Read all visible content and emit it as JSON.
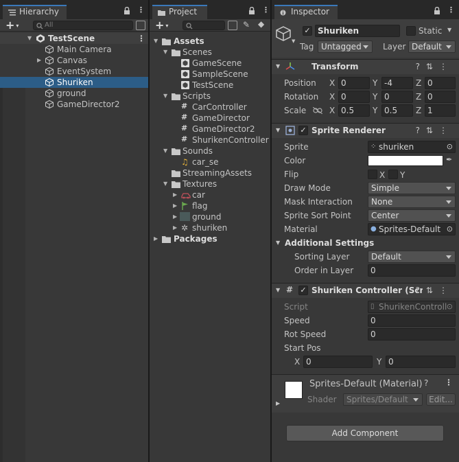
{
  "hierarchy": {
    "tab_label": "Hierarchy",
    "search_placeholder": "All",
    "scene": "TestScene",
    "items": [
      "Main Camera",
      "Canvas",
      "EventSystem",
      "Shuriken",
      "ground",
      "GameDirector2"
    ]
  },
  "project": {
    "tab_label": "Project",
    "assets": "Assets",
    "scenes_folder": "Scenes",
    "scenes": [
      "GameScene",
      "SampleScene",
      "TestScene"
    ],
    "scripts_folder": "Scripts",
    "scripts": [
      "CarController",
      "GameDirector",
      "GameDirector2",
      "ShurikenController"
    ],
    "sounds_folder": "Sounds",
    "sounds": [
      "car_se"
    ],
    "streaming": "StreamingAssets",
    "textures_folder": "Textures",
    "textures": [
      "car",
      "flag",
      "ground",
      "shuriken"
    ],
    "packages": "Packages"
  },
  "inspector": {
    "tab_label": "Inspector",
    "object_name": "Shuriken",
    "static_label": "Static",
    "tag_label": "Tag",
    "tag_value": "Untagged",
    "layer_label": "Layer",
    "layer_value": "Default",
    "transform": {
      "title": "Transform",
      "position_label": "Position",
      "pos": {
        "x": "0",
        "y": "-4",
        "z": "0"
      },
      "rotation_label": "Rotation",
      "rot": {
        "x": "0",
        "y": "0",
        "z": "0"
      },
      "scale_label": "Scale",
      "scale": {
        "x": "0.5",
        "y": "0.5",
        "z": "1"
      },
      "x": "X",
      "y": "Y",
      "z": "Z"
    },
    "sprite_renderer": {
      "title": "Sprite Renderer",
      "sprite_label": "Sprite",
      "sprite_value": "shuriken",
      "color_label": "Color",
      "flip_label": "Flip",
      "flip_x": "X",
      "flip_y": "Y",
      "draw_mode_label": "Draw Mode",
      "draw_mode_value": "Simple",
      "mask_label": "Mask Interaction",
      "mask_value": "None",
      "sort_point_label": "Sprite Sort Point",
      "sort_point_value": "Center",
      "material_label": "Material",
      "material_value": "Sprites-Default",
      "additional_label": "Additional Settings",
      "sorting_layer_label": "Sorting Layer",
      "sorting_layer_value": "Default",
      "order_label": "Order in Layer",
      "order_value": "0"
    },
    "shuriken_controller": {
      "title": "Shuriken Controller (Scrip",
      "script_label": "Script",
      "script_value": "ShurikenControll",
      "speed_label": "Speed",
      "speed_value": "0",
      "rot_speed_label": "Rot Speed",
      "rot_speed_value": "0",
      "start_pos_label": "Start Pos",
      "x_label": "X",
      "x_value": "0",
      "y_label": "Y",
      "y_value": "0"
    },
    "material": {
      "title": "Sprites-Default (Material)",
      "shader_label": "Shader",
      "shader_value": "Sprites/Default",
      "edit_label": "Edit..."
    },
    "add_component": "Add Component"
  },
  "colors": {
    "selection": "#2c5d87",
    "tab_accent": "#3a79bb",
    "panel": "#383838"
  }
}
